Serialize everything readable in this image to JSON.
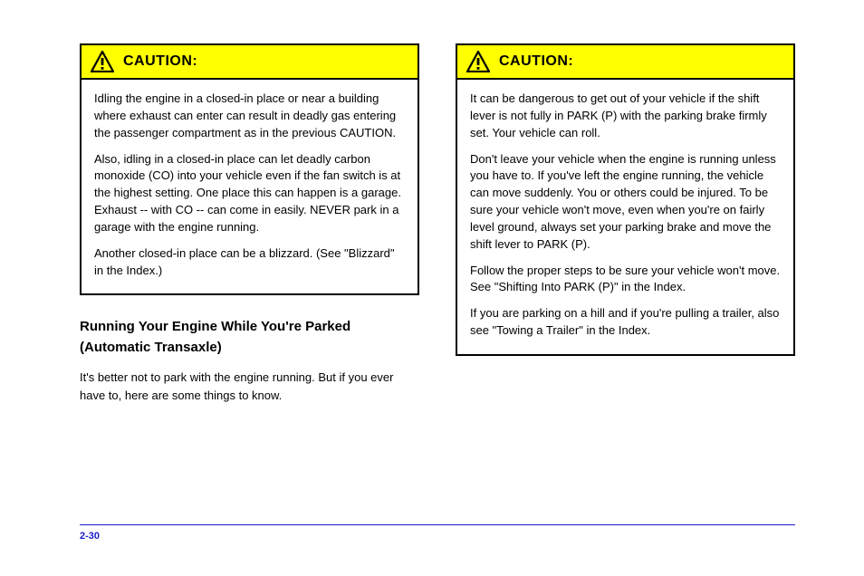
{
  "warnings": [
    {
      "title": "CAUTION:",
      "paragraphs": [
        "Idling the engine in a closed-in place or near a building where exhaust can enter can result in deadly gas entering the passenger compartment as in the previous CAUTION.",
        "Also, idling in a closed-in place can let deadly carbon monoxide (CO) into your vehicle even if the fan switch is at the highest setting. One place this can happen is a garage. Exhaust -- with CO -- can come in easily. NEVER park in a garage with the engine running.",
        "Another closed-in place can be a blizzard. (See \"Blizzard\" in the Index.)"
      ]
    },
    {
      "title": "CAUTION:",
      "paragraphs": [
        "It can be dangerous to get out of your vehicle if the shift lever is not fully in PARK (P) with the parking brake firmly set. Your vehicle can roll.",
        "Don't leave your vehicle when the engine is running unless you have to. If you've left the engine running, the vehicle can move suddenly. You or others could be injured. To be sure your vehicle won't move, even when you're on fairly level ground, always set your parking brake and move the shift lever to PARK (P).",
        "Follow the proper steps to be sure your vehicle won't move. See \"Shifting Into PARK (P)\" in the Index.",
        "If you are parking on a hill and if you're pulling a trailer, also see \"Towing a Trailer\" in the Index."
      ]
    }
  ],
  "right_heading": "Running Your Engine While You're Parked (Automatic Transaxle)",
  "right_paragraphs": [
    "It's better not to park with the engine running. But if you ever have to, here are some things to know."
  ],
  "footer": {
    "left": "2-30",
    "right": ""
  }
}
